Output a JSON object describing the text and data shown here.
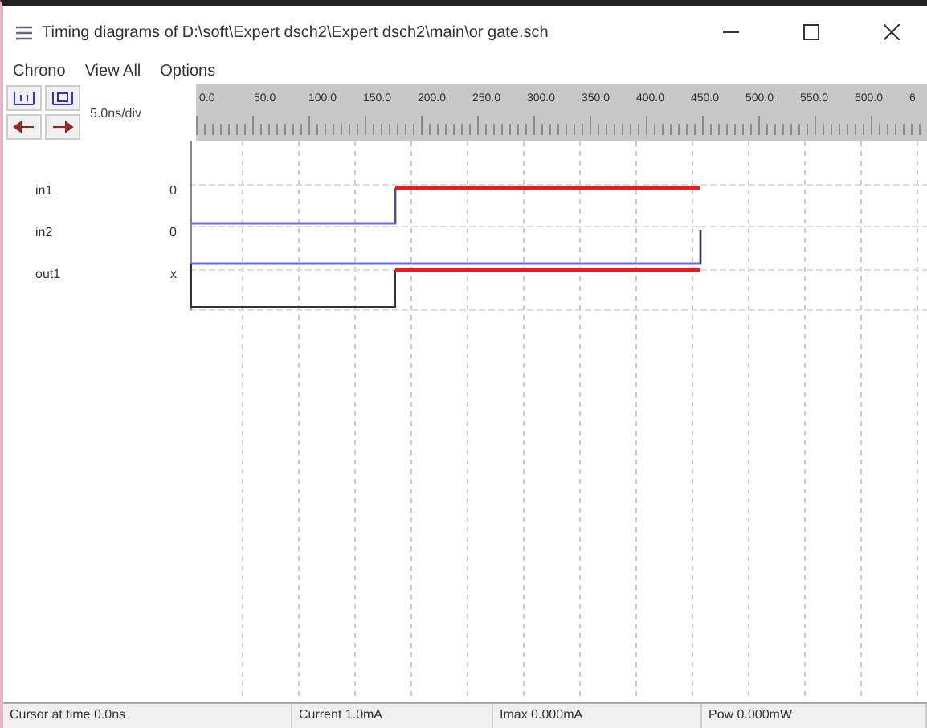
{
  "window": {
    "title": "Timing diagrams of D:\\soft\\Expert dsch2\\Expert dsch2\\main\\or gate.sch"
  },
  "menu": [
    "Chrono",
    "View All",
    "Options"
  ],
  "toolbar": {
    "scale": "5.0ns/div"
  },
  "ruler": {
    "labels": [
      "0.0",
      "50.0",
      "100.0",
      "150.0",
      "200.0",
      "250.0",
      "300.0",
      "350.0",
      "400.0",
      "450.0",
      "500.0",
      "550.0",
      "600.0",
      "6"
    ]
  },
  "signals": [
    {
      "name": "in1",
      "value": "0"
    },
    {
      "name": "in2",
      "value": "0"
    },
    {
      "name": "out1",
      "value": "x"
    }
  ],
  "status_bar": [
    "Cursor at time 0.0ns",
    "Current 1.0mA",
    "Imax 0.000mA",
    "Pow 0.000mW"
  ]
}
